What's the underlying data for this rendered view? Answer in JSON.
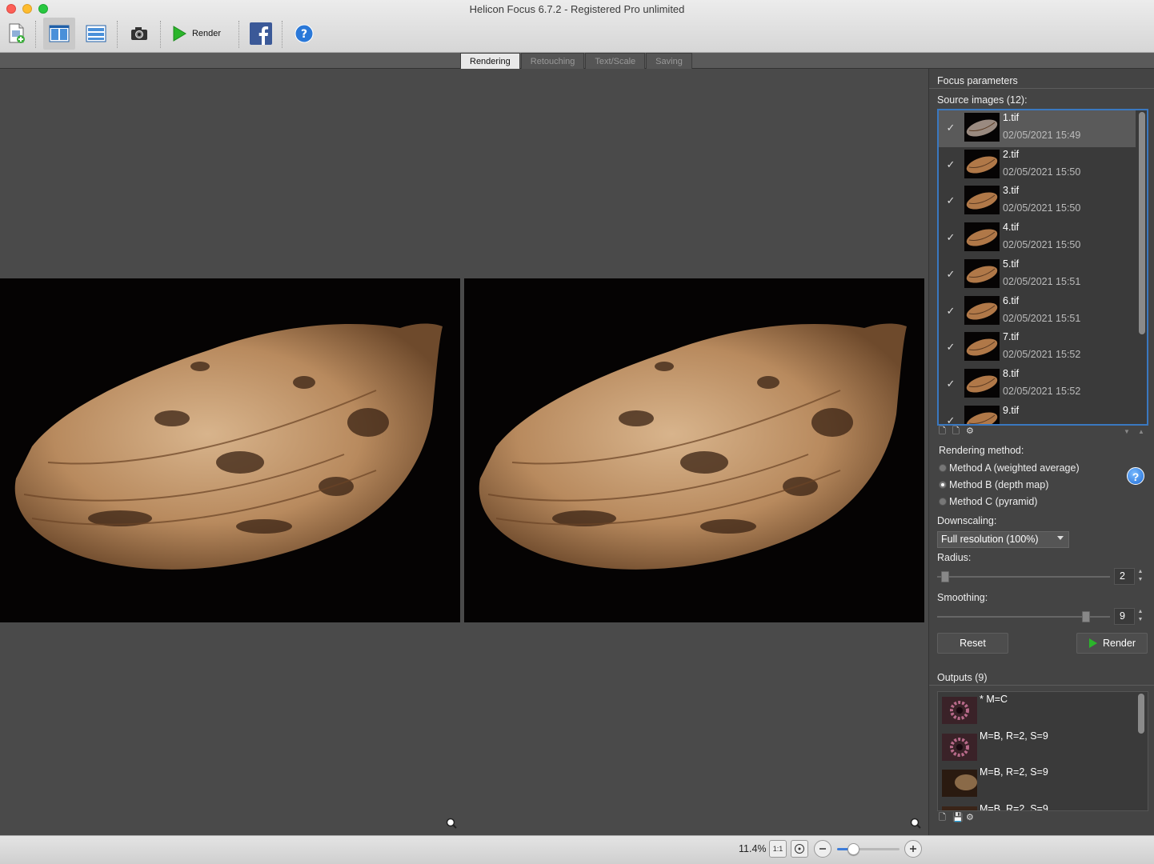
{
  "window": {
    "title": "Helicon Focus 6.7.2 - Registered Pro unlimited"
  },
  "toolbar": {
    "render_label": "Render",
    "icons": [
      "add-images-icon",
      "split-view-icon",
      "list-view-icon",
      "camera-icon",
      "render-play-icon",
      "facebook-icon",
      "help-icon"
    ]
  },
  "tabs": [
    {
      "label": "Rendering",
      "active": true
    },
    {
      "label": "Retouching",
      "active": false
    },
    {
      "label": "Text/Scale",
      "active": false
    },
    {
      "label": "Saving",
      "active": false
    }
  ],
  "panel": {
    "title": "Focus parameters",
    "source_label": "Source images (12):",
    "source_images": [
      {
        "name": "1.tif",
        "date": "02/05/2021 15:49",
        "checked": true,
        "selected": true
      },
      {
        "name": "2.tif",
        "date": "02/05/2021 15:50",
        "checked": true
      },
      {
        "name": "3.tif",
        "date": "02/05/2021 15:50",
        "checked": true
      },
      {
        "name": "4.tif",
        "date": "02/05/2021 15:50",
        "checked": true
      },
      {
        "name": "5.tif",
        "date": "02/05/2021 15:51",
        "checked": true
      },
      {
        "name": "6.tif",
        "date": "02/05/2021 15:51",
        "checked": true
      },
      {
        "name": "7.tif",
        "date": "02/05/2021 15:52",
        "checked": true
      },
      {
        "name": "8.tif",
        "date": "02/05/2021 15:52",
        "checked": true
      },
      {
        "name": "9.tif",
        "date": "",
        "checked": true
      }
    ],
    "rendering_method_label": "Rendering method:",
    "methods": [
      {
        "label": "Method A (weighted average)",
        "selected": false
      },
      {
        "label": "Method B (depth map)",
        "selected": true
      },
      {
        "label": "Method C (pyramid)",
        "selected": false
      }
    ],
    "downscaling_label": "Downscaling:",
    "downscaling_value": "Full resolution (100%)",
    "radius_label": "Radius:",
    "radius_value": "2",
    "smoothing_label": "Smoothing:",
    "smoothing_value": "9",
    "reset_label": "Reset",
    "render_label": "Render",
    "outputs_label": "Outputs (9)",
    "outputs": [
      {
        "label": "* M=C"
      },
      {
        "label": "M=B, R=2, S=9"
      },
      {
        "label": "M=B, R=2, S=9"
      },
      {
        "label": "M=B, R=2, S=9"
      }
    ]
  },
  "status": {
    "zoom": "11.4%",
    "zoom_slider_fraction": 0.25,
    "one_to_one": "1:1"
  },
  "colors": {
    "accent": "#3a78c0",
    "panel_bg": "#444444",
    "viewer_bg": "#4a4a4a",
    "render_green": "#2bb52b"
  }
}
